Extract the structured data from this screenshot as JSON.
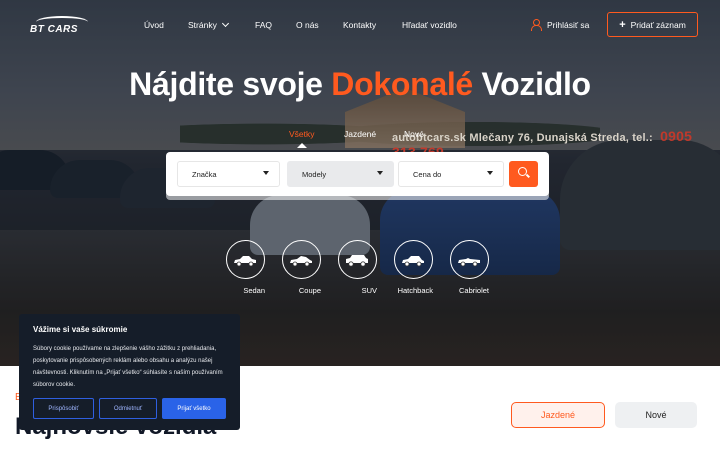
{
  "brand": {
    "logo_text": "BT CARS"
  },
  "nav": {
    "items": [
      "Úvod",
      "Stránky",
      "FAQ",
      "O nás",
      "Kontakty",
      "Hľadať vozidlo"
    ],
    "login": "Prihlásiť sa",
    "add_listing": "Pridať záznam"
  },
  "hero": {
    "title_part1": "Nájdite svoje ",
    "title_accent": "Dokonalé",
    "title_part2": " Vozidlo",
    "sign_text": "autobtcars.sk  Mlečany 76, Dunajská Streda, tel.:",
    "sign_phone": "0905 313 769"
  },
  "search": {
    "tabs": [
      "Všetky",
      "Jazdené",
      "Nové"
    ],
    "active_tab": "Všetky",
    "fields": {
      "brand": "Značka",
      "model": "Modely",
      "price": "Cena do"
    }
  },
  "body_types": [
    "Sedan",
    "Coupe",
    "SUV",
    "Hatchback",
    "Cabriolet"
  ],
  "cookie": {
    "title": "Vážime si vaše súkromie",
    "text": "Súbory cookie používame na zlepšenie vášho zážitku z prehliadania, poskytovanie prispôsobených reklám alebo obsahu a analýzu našej návštevnosti. Kliknutím na „Prijať všetko“ súhlasíte s naším používaním súborov cookie.",
    "btn_customize": "Prispôsobiť",
    "btn_reject": "Odmietnuť",
    "btn_accept": "Prijať všetko"
  },
  "section": {
    "tag": "E",
    "title": "Najnovšie vozidlá",
    "filters": [
      "Jazdené",
      "Nové"
    ]
  },
  "colors": {
    "accent": "#ff5a1f",
    "cookie_bg": "#151d29",
    "cookie_btn": "#2a63e8"
  }
}
